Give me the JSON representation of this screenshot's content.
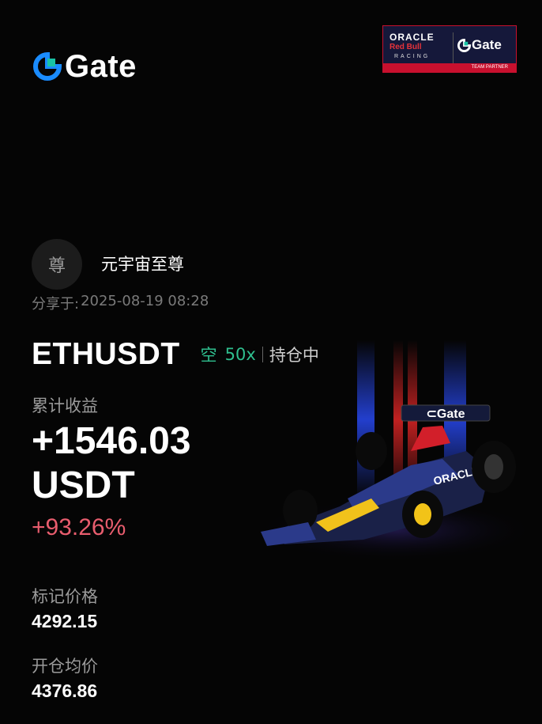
{
  "brand": {
    "name": "Gate",
    "accent": "#1a8cff",
    "accent2": "#19c3a5"
  },
  "partner_badge": {
    "oracle": "ORACLE",
    "red_bull": "Red Bull",
    "racing": "RACING",
    "gate": "Gate",
    "team_partner": "TEAM PARTNER"
  },
  "user": {
    "avatar_char": "尊",
    "name": "元宇宙至尊"
  },
  "share": {
    "label": "分享于:",
    "time": "2025-08-19 08:28"
  },
  "position": {
    "pair": "ETHUSDT",
    "side": "空",
    "leverage": "50x",
    "status": "持仓中"
  },
  "pnl": {
    "label": "累计收益",
    "amount": "+1546.03",
    "currency": "USDT",
    "percent": "+93.26%"
  },
  "mark_price": {
    "label": "标记价格",
    "value": "4292.15"
  },
  "entry_price": {
    "label": "开仓均价",
    "value": "4376.86"
  },
  "colors": {
    "short": "#2fbf8f",
    "profit_pct": "#e85d6e",
    "muted": "#9a9a9a"
  }
}
